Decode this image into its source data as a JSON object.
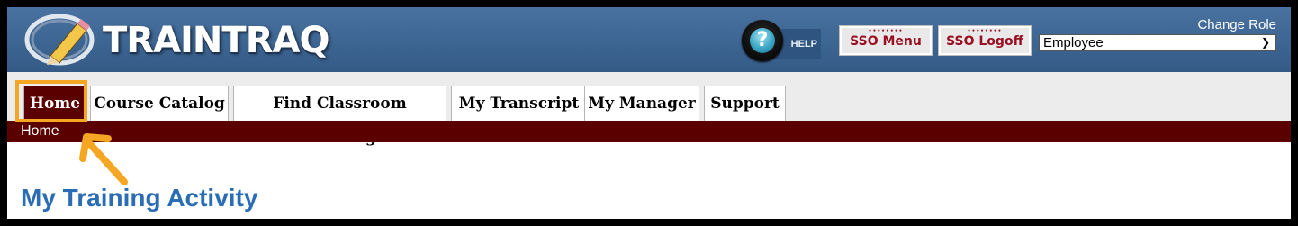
{
  "header": {
    "logo_text": "TRAINTRAQ",
    "help_label": "HELP",
    "sso_menu_label": "SSO Menu",
    "sso_logoff_label": "SSO Logoff",
    "change_role_label": "Change Role",
    "role_selected": "Employee"
  },
  "nav": {
    "tabs": [
      {
        "label": "Home",
        "active": true
      },
      {
        "label": "Course Catalog",
        "active": false
      },
      {
        "label": "Find Classroom Training",
        "active": false
      },
      {
        "label": "My Transcript",
        "active": false
      },
      {
        "label": "My Manager",
        "active": false
      },
      {
        "label": "Support",
        "active": false
      }
    ]
  },
  "breadcrumb": "Home",
  "main": {
    "title": "My Training Activity"
  },
  "colors": {
    "header_blue": "#3c6491",
    "active_tab": "#5a0000",
    "highlight": "#f5a623",
    "title": "#2a6db5"
  }
}
